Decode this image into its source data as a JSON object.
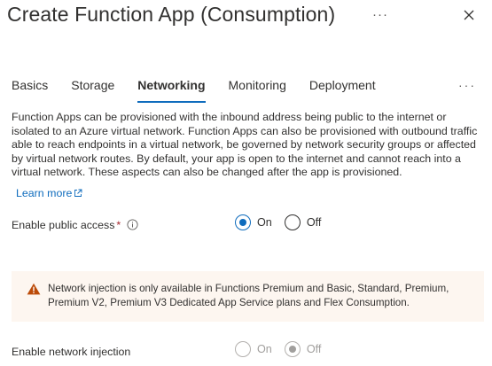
{
  "header": {
    "title": "Create Function App (Consumption)",
    "more_label": "···",
    "close_icon": "close-icon"
  },
  "tabs": [
    {
      "label": "Basics",
      "active": false
    },
    {
      "label": "Storage",
      "active": false
    },
    {
      "label": "Networking",
      "active": true
    },
    {
      "label": "Monitoring",
      "active": false
    },
    {
      "label": "Deployment",
      "active": false
    }
  ],
  "tabs_more_label": "···",
  "description": "Function Apps can be provisioned with the inbound address being public to the internet or isolated to an Azure virtual network. Function Apps can also be provisioned with outbound traffic able to reach endpoints in a virtual network, be governed by network security groups or affected by virtual network routes. By default, your app is open to the internet and cannot reach into a virtual network. These aspects can also be changed after the app is provisioned.",
  "learn_more": "Learn more",
  "public_access": {
    "label": "Enable public access",
    "required_mark": "*",
    "options": [
      {
        "label": "On",
        "selected": true
      },
      {
        "label": "Off",
        "selected": false
      }
    ]
  },
  "warning": {
    "icon": "warning-icon",
    "text": "Network injection is only available in Functions Premium and Basic, Standard, Premium, Premium V2, Premium V3 Dedicated App Service plans and Flex Consumption."
  },
  "network_injection": {
    "label": "Enable network injection",
    "options": [
      {
        "label": "On",
        "selected": false
      },
      {
        "label": "Off",
        "selected": true
      }
    ],
    "disabled": true
  },
  "colors": {
    "accent": "#0f6cbd",
    "warning_bg": "#fdf6f0",
    "warning_icon": "#bc4b09",
    "required": "#a4262c"
  }
}
